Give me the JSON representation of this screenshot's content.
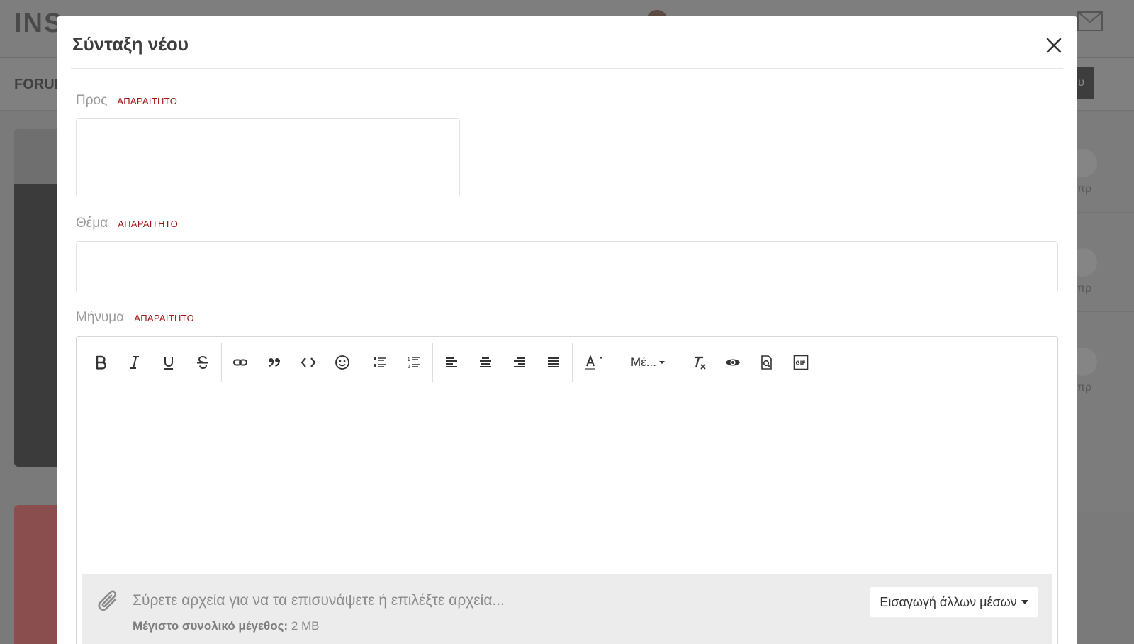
{
  "background": {
    "logo": "INS",
    "forum": "FORUM",
    "button": "υ",
    "right_rows": [
      "πρ",
      "πρ",
      "πρ"
    ]
  },
  "modal": {
    "title": "Σύνταξη νέου",
    "required_label": "ΑΠΑΡΑΙΤΗΤΟ",
    "to": {
      "label": "Προς",
      "value": ""
    },
    "subject": {
      "label": "Θέμα",
      "value": "",
      "placeholder": ""
    },
    "message": {
      "label": "Μήνυμα"
    },
    "toolbar": {
      "groups": [
        [
          "bold-icon",
          "italic-icon",
          "underline-icon",
          "strikethrough-icon"
        ],
        [
          "link-icon",
          "quote-icon",
          "code-icon",
          "emoji-icon"
        ],
        [
          "bullet-list-icon",
          "numbered-list-icon"
        ],
        [
          "align-left-icon",
          "align-center-icon",
          "align-right-icon",
          "align-justify-icon"
        ],
        [
          "text-color-icon",
          "font-size-select",
          "remove-format-icon",
          "preview-icon",
          "preview-page-icon",
          "gif-icon"
        ]
      ],
      "font_size_label": "Μέ..."
    },
    "attachments": {
      "drop_text": "Σύρετε αρχεία για να τα επισυνάψετε ή επιλέξτε αρχεία...",
      "limit_label": "Μέγιστο συνολικό μέγεθος:",
      "limit_value": "2 MB",
      "more_media": "Εισαγωγή άλλων μέσων"
    }
  }
}
